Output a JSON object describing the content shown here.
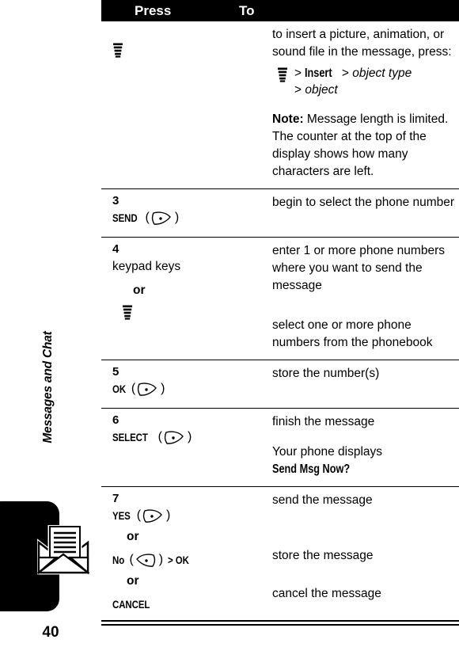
{
  "page": {
    "number": "40",
    "chapter_label": "Messages and Chat",
    "chapter_icon": "envelope-icon"
  },
  "table": {
    "headers": {
      "press": "Press",
      "to": "To"
    },
    "rows": [
      {
        "step": "",
        "press_icon": "menu-key-icon",
        "to_intro": "to insert a picture, animation, or sound file in the message, press:",
        "to_sequence_icon": "menu-key-icon",
        "to_sequence": "> Insert > object type > object",
        "to_sequence_part1": "Insert",
        "to_sequence_part2": "object type",
        "to_sequence_part3": "object",
        "note_label": "Note:",
        "note_text": "Message length is limited. The counter at the top of the display shows how many characters are left."
      },
      {
        "step": "3",
        "press_label": "SEND",
        "press_icon": "right-softkey-icon",
        "to_text": "begin to select the phone number"
      },
      {
        "step": "4",
        "press_label": "keypad keys",
        "or_label": "or",
        "press_alt_icon": "menu-key-icon",
        "to_text": "enter 1 or more phone numbers where you want to send the message",
        "to_alt_text": "select one or more phone numbers from the phonebook"
      },
      {
        "step": "5",
        "press_label": "OK",
        "press_icon": "right-softkey-icon",
        "to_text": "store the number(s)"
      },
      {
        "step": "6",
        "press_label": "SELECT",
        "press_icon": "right-softkey-icon",
        "to_text": "finish the message",
        "to_text2_prefix": "Your phone displays ",
        "to_text2_bold": "Send Msg Now?"
      },
      {
        "step": "7",
        "press_label": "YES",
        "press_icon": "right-softkey-icon",
        "or_label": "or",
        "press_alt_label": "No",
        "press_alt_icon": "left-softkey-icon",
        "press_alt_suffix": "> OK",
        "or_label2": "or",
        "press_alt2_label": "CANCEL",
        "to_text": "send the message",
        "to_alt_text": "store the message",
        "to_alt2_text": "cancel the message"
      }
    ]
  }
}
